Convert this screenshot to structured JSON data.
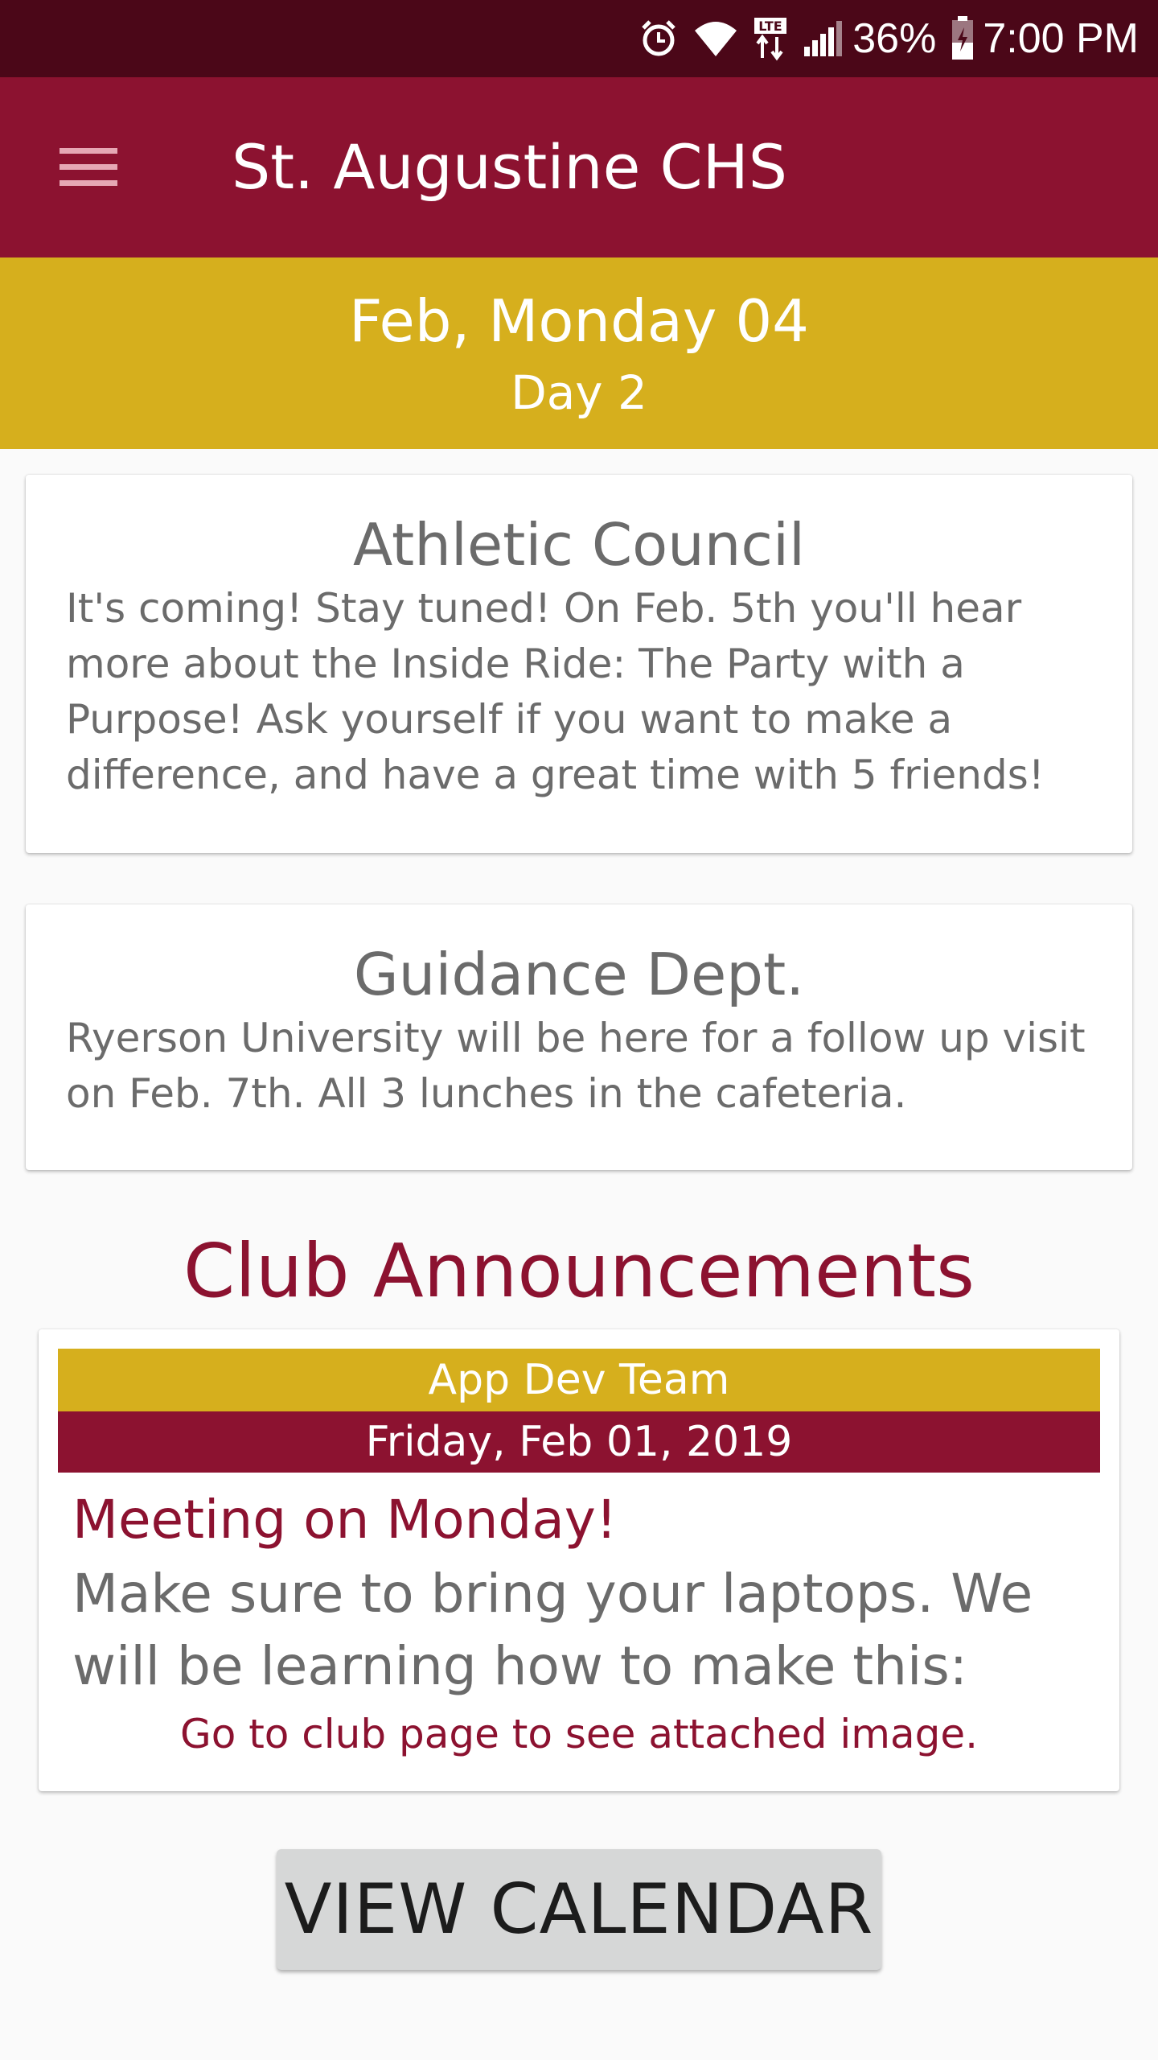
{
  "status_bar": {
    "battery": "36%",
    "time": "7:00 PM",
    "icons": [
      "alarm-icon",
      "wifi-icon",
      "lte-icon",
      "signal-icon",
      "battery-icon"
    ],
    "lte_label": "LTE"
  },
  "app_bar": {
    "title": "St. Augustine CHS",
    "menu_icon": "hamburger-menu-icon"
  },
  "date_banner": {
    "date": "Feb, Monday 04",
    "day": "Day 2"
  },
  "announcements": [
    {
      "title": "Athletic Council",
      "body": "It's coming!  Stay tuned!  On Feb. 5th you'll hear more about the Inside Ride: The Party with a Purpose!  Ask yourself if you want to make a difference, and have a great time with 5 friends!"
    },
    {
      "title": "Guidance Dept.",
      "body": "Ryerson University will be here for a follow up visit on Feb. 7th. All 3 lunches in the cafeteria."
    }
  ],
  "club_section": {
    "heading": "Club Announcements",
    "club_name": "App Dev Team",
    "date": "Friday, Feb 01, 2019",
    "post_title": "Meeting on Monday!",
    "post_body": "Make sure to bring your laptops. We will be learning how to make this:",
    "link_text": "Go to club page to see attached image."
  },
  "view_calendar_label": "VIEW CALENDAR",
  "colors": {
    "status_bar": "#4b0718",
    "primary": "#8c1230",
    "accent": "#d6af1d",
    "card_text": "#6b6b6b",
    "button_bg": "#d6d7d7"
  }
}
